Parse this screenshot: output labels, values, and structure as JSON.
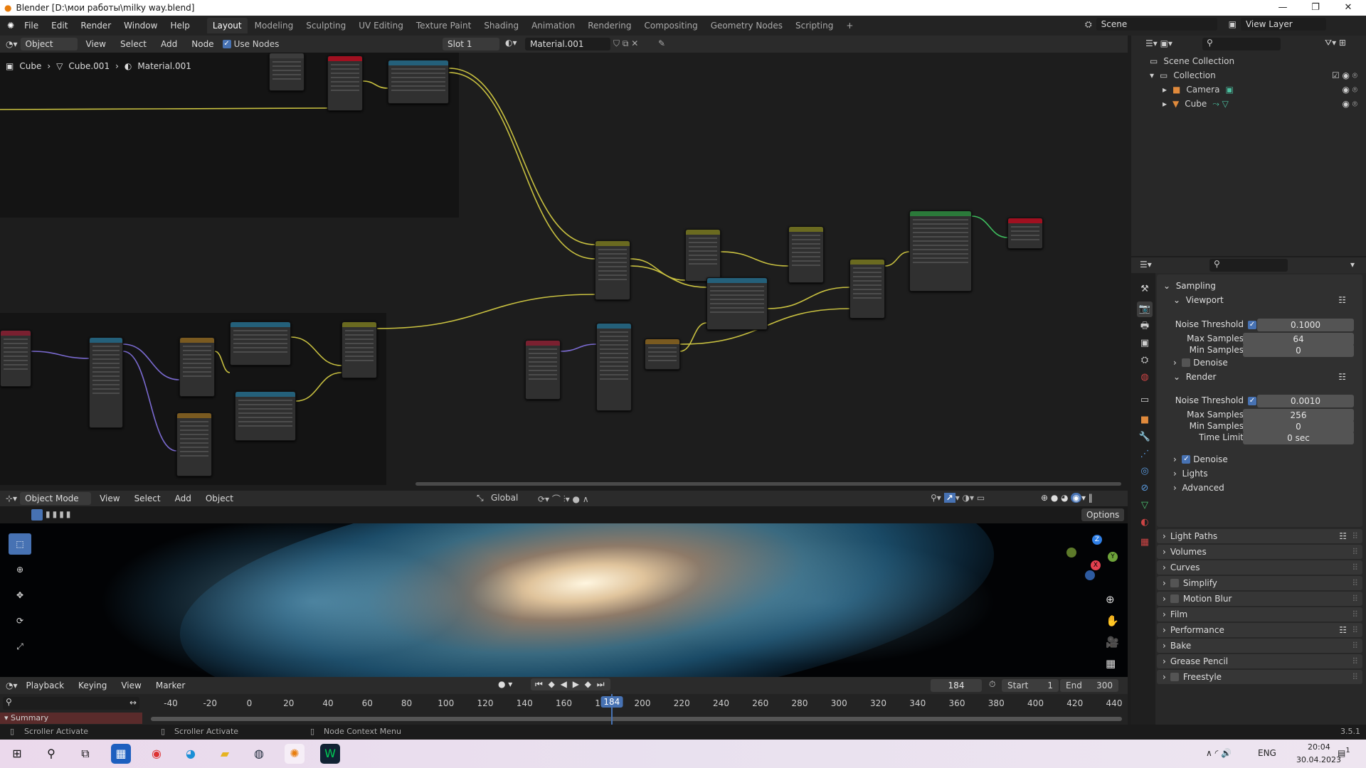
{
  "window": {
    "title": "Blender [D:\\мои работы\\milky way.blend]",
    "min": "—",
    "max": "❐",
    "close": "✕"
  },
  "menu": [
    "File",
    "Edit",
    "Render",
    "Window",
    "Help"
  ],
  "workspaces": [
    "Layout",
    "Modeling",
    "Sculpting",
    "UV Editing",
    "Texture Paint",
    "Shading",
    "Animation",
    "Rendering",
    "Compositing",
    "Geometry Nodes",
    "Scripting",
    "+"
  ],
  "scene": {
    "name": "Scene",
    "view_layer": "View Layer"
  },
  "node_header": {
    "mode": "Object",
    "items": [
      "View",
      "Select",
      "Add",
      "Node"
    ],
    "use_nodes": "Use Nodes",
    "slot": "Slot 1",
    "material": "Material.001"
  },
  "breadcrumb": [
    "Cube",
    "Cube.001",
    "Material.001"
  ],
  "viewport_header": {
    "mode": "Object Mode",
    "items": [
      "View",
      "Select",
      "Add",
      "Object"
    ],
    "orientation": "Global",
    "options": "Options"
  },
  "outliner": {
    "root": "Scene Collection",
    "collection": "Collection",
    "items": [
      "Camera",
      "Cube"
    ]
  },
  "props": {
    "sampling": "Sampling",
    "viewport": "Viewport",
    "render": "Render",
    "noise_threshold": "Noise Threshold",
    "max_samples": "Max Samples",
    "min_samples": "Min Samples",
    "time_limit": "Time Limit",
    "vp_noise": "0.1000",
    "vp_max": "64",
    "vp_min": "0",
    "r_noise": "0.0010",
    "r_max": "256",
    "r_min": "0",
    "r_time": "0 sec",
    "denoise": "Denoise",
    "lights": "Lights",
    "advanced": "Advanced",
    "panels": [
      "Light Paths",
      "Volumes",
      "Curves",
      "Simplify",
      "Motion Blur",
      "Film",
      "Performance",
      "Bake",
      "Grease Pencil",
      "Freestyle"
    ]
  },
  "timeline": {
    "items": [
      "Playback",
      "Keying",
      "View",
      "Marker"
    ],
    "current": "184",
    "start_label": "Start",
    "start": "1",
    "end_label": "End",
    "end": "300",
    "summary": "Summary",
    "ticks": [
      -40,
      -20,
      0,
      20,
      40,
      60,
      80,
      100,
      120,
      140,
      160,
      180,
      200,
      220,
      240,
      260,
      280,
      300,
      320,
      340,
      360,
      380,
      400,
      420,
      440
    ]
  },
  "status": {
    "left": "Scroller Activate",
    "middle": "Scroller Activate",
    "right": "Node Context Menu",
    "version": "3.5.1"
  },
  "taskbar": {
    "lang": "ENG",
    "time": "20:04",
    "date": "30.04.2023",
    "notifications": "1"
  }
}
